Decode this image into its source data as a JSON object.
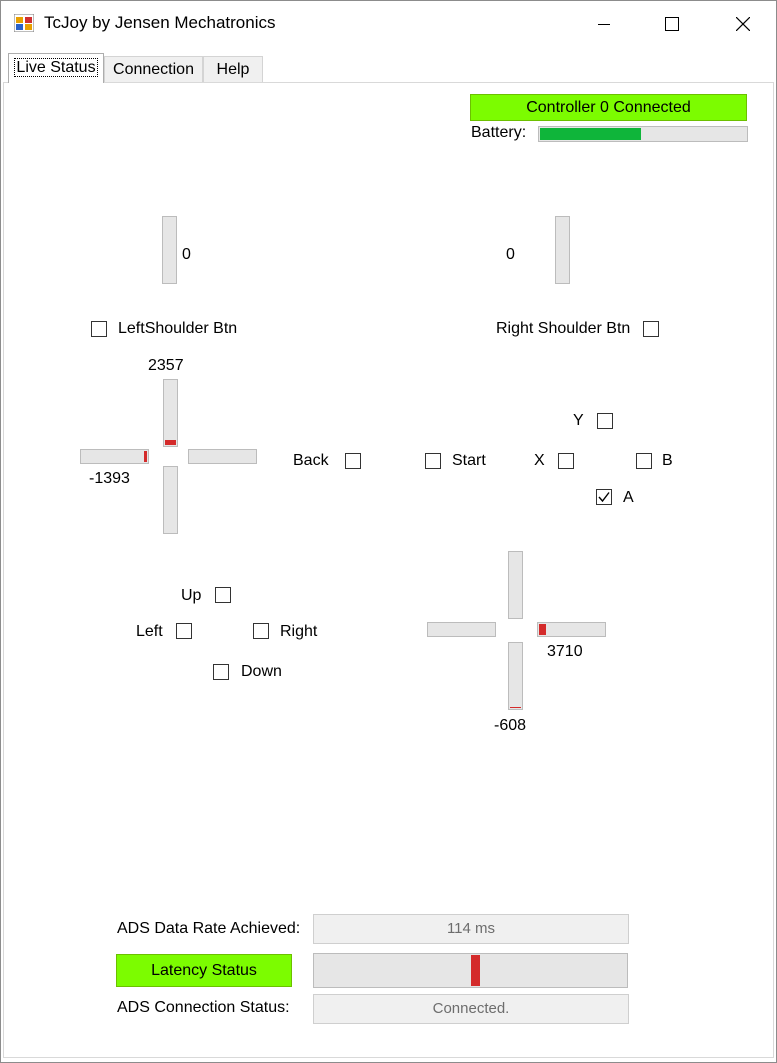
{
  "window": {
    "title": "TcJoy by Jensen Mechatronics",
    "icon": "app-icon",
    "controls": [
      "minimize-icon",
      "maximize-icon",
      "close-icon"
    ]
  },
  "tabs": [
    {
      "label": "Live Status",
      "active": true
    },
    {
      "label": "Connection",
      "active": false
    },
    {
      "label": "Help",
      "active": false
    }
  ],
  "status": {
    "controller_label": "Controller 0 Connected",
    "controller_color": "#7cfc00",
    "battery_label": "Battery:",
    "battery_level": 0.49,
    "battery_color": "#0fb53a"
  },
  "triggers": {
    "left_value": "0",
    "right_value": "0",
    "left_level": 0,
    "right_level": 0
  },
  "shoulders": {
    "left_label": "LeftShoulder Btn",
    "left_checked": false,
    "right_label": "Right Shoulder Btn",
    "right_checked": false
  },
  "left_stick": {
    "y_value": "2357",
    "x_value": "-1393",
    "y_level": 0.072,
    "x_level": -0.043
  },
  "right_stick": {
    "x_value": "3710",
    "y_value": "-608",
    "x_level": 0.113,
    "y_level": -0.019
  },
  "buttons": {
    "back": {
      "label": "Back",
      "checked": false
    },
    "start": {
      "label": "Start",
      "checked": false
    },
    "y": {
      "label": "Y",
      "checked": false
    },
    "x": {
      "label": "X",
      "checked": false
    },
    "b": {
      "label": "B",
      "checked": false
    },
    "a": {
      "label": "A",
      "checked": true
    }
  },
  "dpad": {
    "up": {
      "label": "Up",
      "checked": false
    },
    "left": {
      "label": "Left",
      "checked": false
    },
    "right": {
      "label": "Right",
      "checked": false
    },
    "down": {
      "label": "Down",
      "checked": false
    }
  },
  "ads": {
    "rate_label": "ADS Data Rate Achieved:",
    "rate_value": "114 ms",
    "latency_label": "Latency Status",
    "latency_color": "#7cfc00",
    "latency_level": 0.5,
    "connection_label": "ADS Connection Status:",
    "connection_value": "Connected."
  }
}
